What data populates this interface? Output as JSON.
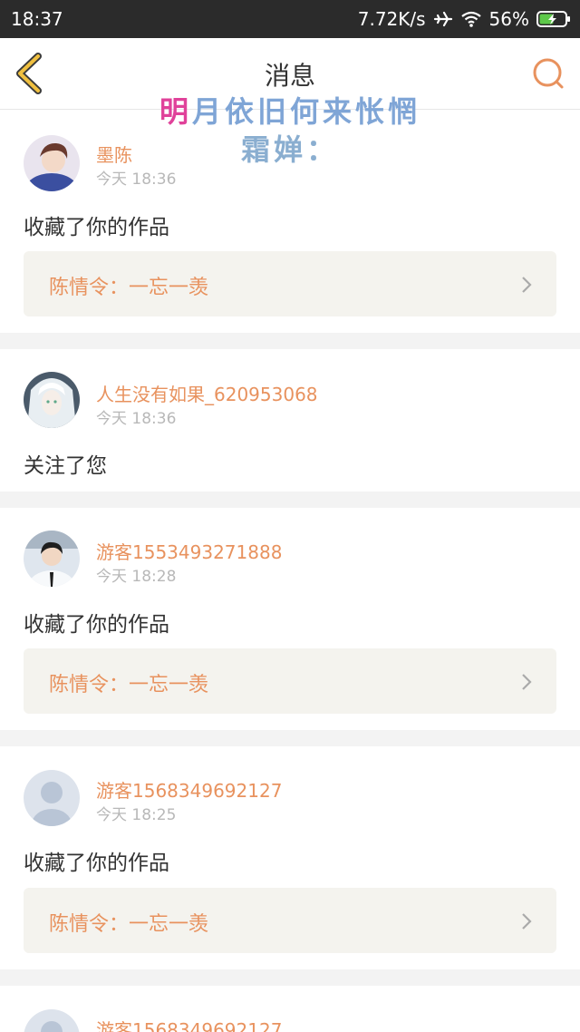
{
  "status_bar": {
    "time": "18:37",
    "net_speed": "7.72K/s",
    "battery": "56%",
    "icons": [
      "airplane-icon",
      "wifi-icon",
      "battery-charging-icon"
    ]
  },
  "header": {
    "title": "消息",
    "back_icon": "chevron-left-icon",
    "search_icon": "search-icon"
  },
  "overlay": {
    "line1_a": "明",
    "line1_b": "月依旧何来怅惘",
    "line2": "霜婵："
  },
  "colors": {
    "accent": "#e8925e",
    "back_icon": "#f0c040",
    "overlay_pink": "#e0429a",
    "overlay_blue": "#7fa5d6",
    "work_box_bg": "#f4f3ee"
  },
  "messages": [
    {
      "username": "墨陈",
      "time": "今天 18:36",
      "action": "收藏了你的作品",
      "work": "陈情令：一忘一羡"
    },
    {
      "username": "人生没有如果_620953068",
      "time": "今天 18:36",
      "action": "关注了您"
    },
    {
      "username": "游客1553493271888",
      "time": "今天 18:28",
      "action": "收藏了你的作品",
      "work": "陈情令：一忘一羡"
    },
    {
      "username": "游客1568349692127",
      "time": "今天 18:25",
      "action": "收藏了你的作品",
      "work": "陈情令：一忘一羡"
    },
    {
      "username": "游客1568349692127"
    }
  ]
}
